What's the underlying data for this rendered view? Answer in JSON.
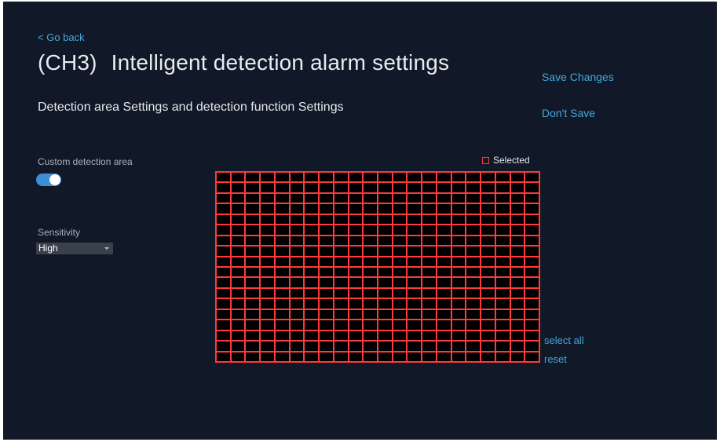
{
  "header": {
    "back_label": "< Go back",
    "channel": "(CH3)",
    "title": "Intelligent detection alarm settings",
    "subtitle": "Detection area Settings and detection function Settings"
  },
  "actions": {
    "save_label": "Save Changes",
    "dont_save_label": "Don't Save"
  },
  "custom_area": {
    "label": "Custom detection area",
    "enabled": true
  },
  "sensitivity": {
    "label": "Sensitivity",
    "selected": "High"
  },
  "detection_grid": {
    "legend_label": "Selected",
    "columns": 22,
    "rows": 18,
    "select_all_label": "select all",
    "reset_label": "reset"
  },
  "colors": {
    "background": "#111827",
    "link": "#47a6df",
    "grid_line": "#ff3a3a",
    "cell": "#000000",
    "toggle_on": "#3e8fd6"
  }
}
